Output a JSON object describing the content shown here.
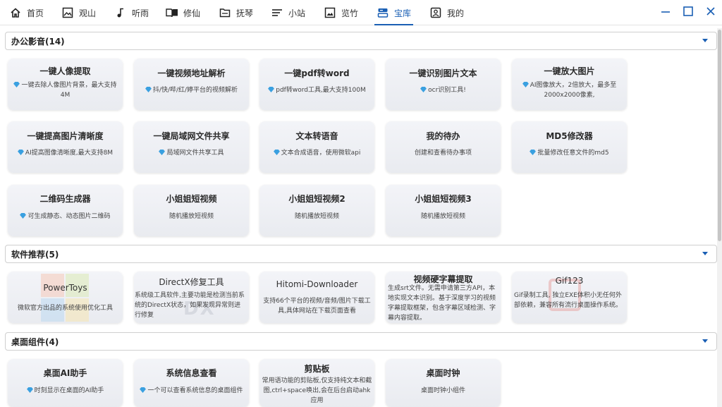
{
  "nav": [
    {
      "label": "首页",
      "icon": "home-icon"
    },
    {
      "label": "观山",
      "icon": "mountain-image-icon"
    },
    {
      "label": "听雨",
      "icon": "music-note-icon"
    },
    {
      "label": "修仙",
      "icon": "book-icon"
    },
    {
      "label": "抚琴",
      "icon": "folder-icon"
    },
    {
      "label": "小站",
      "icon": "menu-lines-icon"
    },
    {
      "label": "览竹",
      "icon": "picture-icon"
    },
    {
      "label": "宝库",
      "icon": "storage-icon",
      "active": true
    },
    {
      "label": "我的",
      "icon": "user-card-icon"
    }
  ],
  "sections": [
    {
      "label": "办公影音(14)"
    },
    {
      "label": "软件推荐(5)"
    },
    {
      "label": "桌面组件(4)"
    }
  ],
  "office": [
    {
      "title": "一键人像提取",
      "desc": "一键去除人像图片背景，最大支持4M",
      "gem": true
    },
    {
      "title": "一键视频地址解析",
      "desc": "抖/快/哔/红/婷平台的视频解析",
      "gem": true
    },
    {
      "title": "一键pdf转word",
      "desc": "pdf转word工具,最大支持100M",
      "gem": true
    },
    {
      "title": "一键识别图片文本",
      "desc": "ocr识别工具!",
      "gem": true
    },
    {
      "title": "一键放大图片",
      "desc": "AI图像放大，2倍放大，最多至2000x2000像素,",
      "gem": true
    },
    {
      "title": "一键提高图片清晰度",
      "desc": "AI提高图像清晰度,最大支持8M",
      "gem": true
    },
    {
      "title": "一键局域网文件共享",
      "desc": "局域网文件共享工具",
      "gem": true
    },
    {
      "title": "文本转语音",
      "desc": "文本合成语音，使用微软api",
      "gem": true
    },
    {
      "title": "我的待办",
      "desc": "创建和查看待办事项",
      "gem": false
    },
    {
      "title": "MD5修改器",
      "desc": "批量修改任意文件的md5",
      "gem": true
    },
    {
      "title": "二维码生成器",
      "desc": "可生成静态、动态图片二维码",
      "gem": true
    },
    {
      "title": "小姐姐短视频",
      "desc": "随机播放短视频",
      "gem": false
    },
    {
      "title": "小姐姐短视频2",
      "desc": "随机播放短视频",
      "gem": false
    },
    {
      "title": "小姐姐短视频3",
      "desc": "随机播放短视频",
      "gem": false
    }
  ],
  "software": [
    {
      "title": "PowerToys",
      "desc": "微软官方出品的系统使用优化工具"
    },
    {
      "title": "DirectX修复工具",
      "desc": "系统级工具软件,主要功能是检测当前系统的DirectX状态，如果发现异常则进行修复"
    },
    {
      "title": "Hitomi-Downloader",
      "desc": "支持66个平台的视频/音频/图片下载工具,具体网站在下载页面查看"
    },
    {
      "title": "视频硬字幕提取",
      "desc": "生成srt文件。无需申请第三方API，本地实现文本识别。基于深度学习的视频字幕提取框架，包含字幕区域检测、字幕内容提取。"
    },
    {
      "title": "Gif123",
      "desc": "Gif录制工具, 独立EXE体积小无任何外部依赖，兼容所有流行桌面操作系统。"
    }
  ],
  "desktop": [
    {
      "title": "桌面AI助手",
      "desc": "时刻显示在桌面的AI助手",
      "gem": true
    },
    {
      "title": "系统信息查看",
      "desc": "一个可以查看系统信息的桌面组件",
      "gem": true
    },
    {
      "title": "剪贴板",
      "desc": "常用语功能的剪贴板,仅支持纯文本和截图,ctrl+space唤出,会在后台启动ahk应用",
      "gem": false
    },
    {
      "title": "桌面时钟",
      "desc": "桌面时钟小组件",
      "gem": false
    }
  ],
  "watermarks": {
    "directx": "DX"
  },
  "colors": {
    "accent": "#1a5fb4",
    "gem": "#3aa0e0"
  }
}
